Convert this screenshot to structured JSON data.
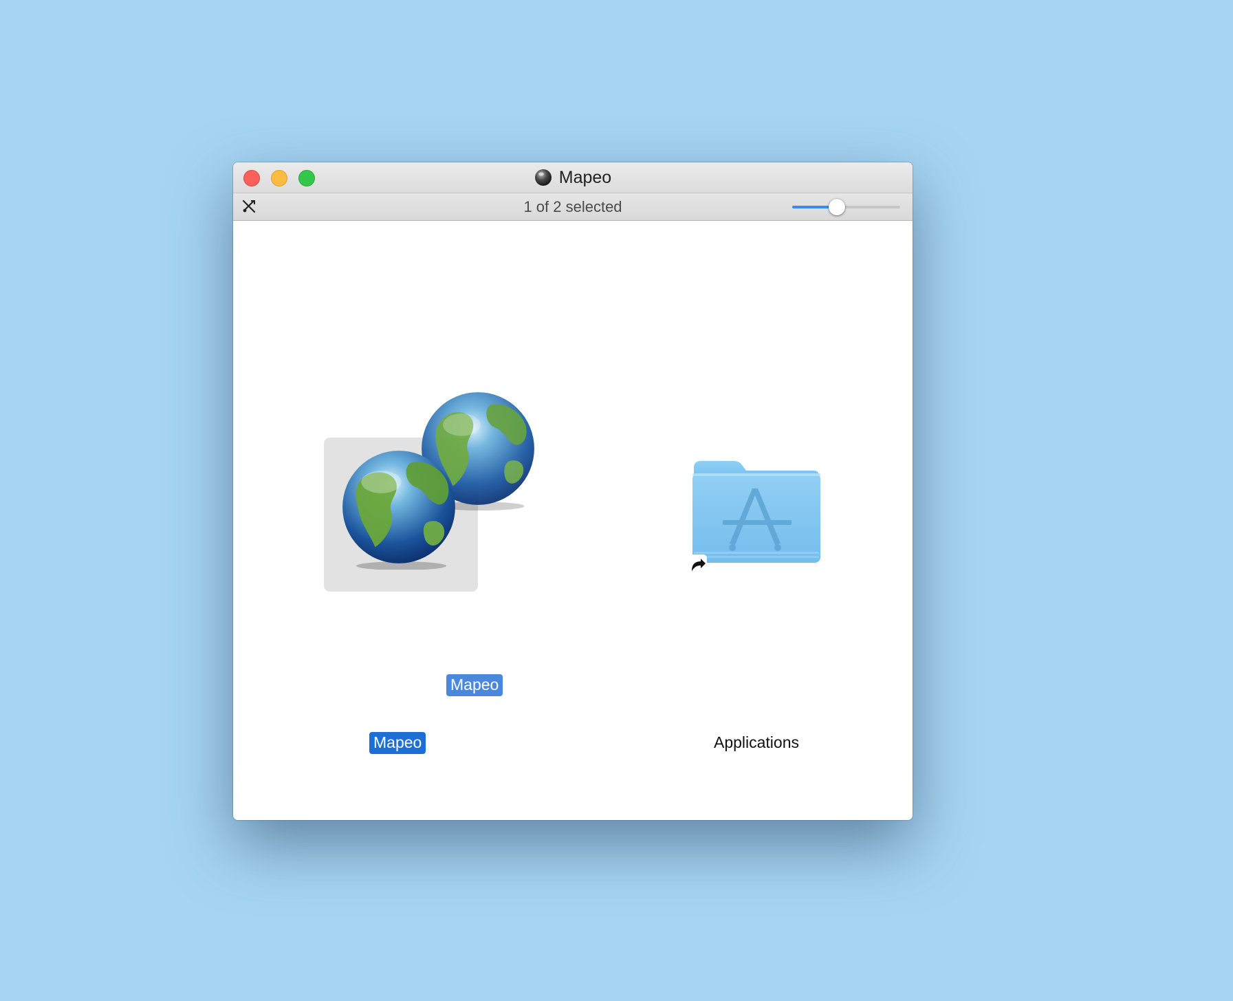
{
  "window": {
    "title": "Mapeo",
    "status_text": "1 of 2 selected",
    "icon_size_slider_level": 0.4
  },
  "items": [
    {
      "label": "Mapeo",
      "selected": true,
      "dragging_ghost_label": "Mapeo"
    },
    {
      "label": "Applications",
      "selected": false,
      "alias": true
    }
  ],
  "colors": {
    "desktop": "#a6d4f2",
    "selection": "#1d6fd6",
    "folder": "#7ec4f0"
  },
  "icons": [
    "globe-icon",
    "folder-applications-icon",
    "alias-arrow-icon",
    "tools-icon",
    "disk-icon"
  ]
}
